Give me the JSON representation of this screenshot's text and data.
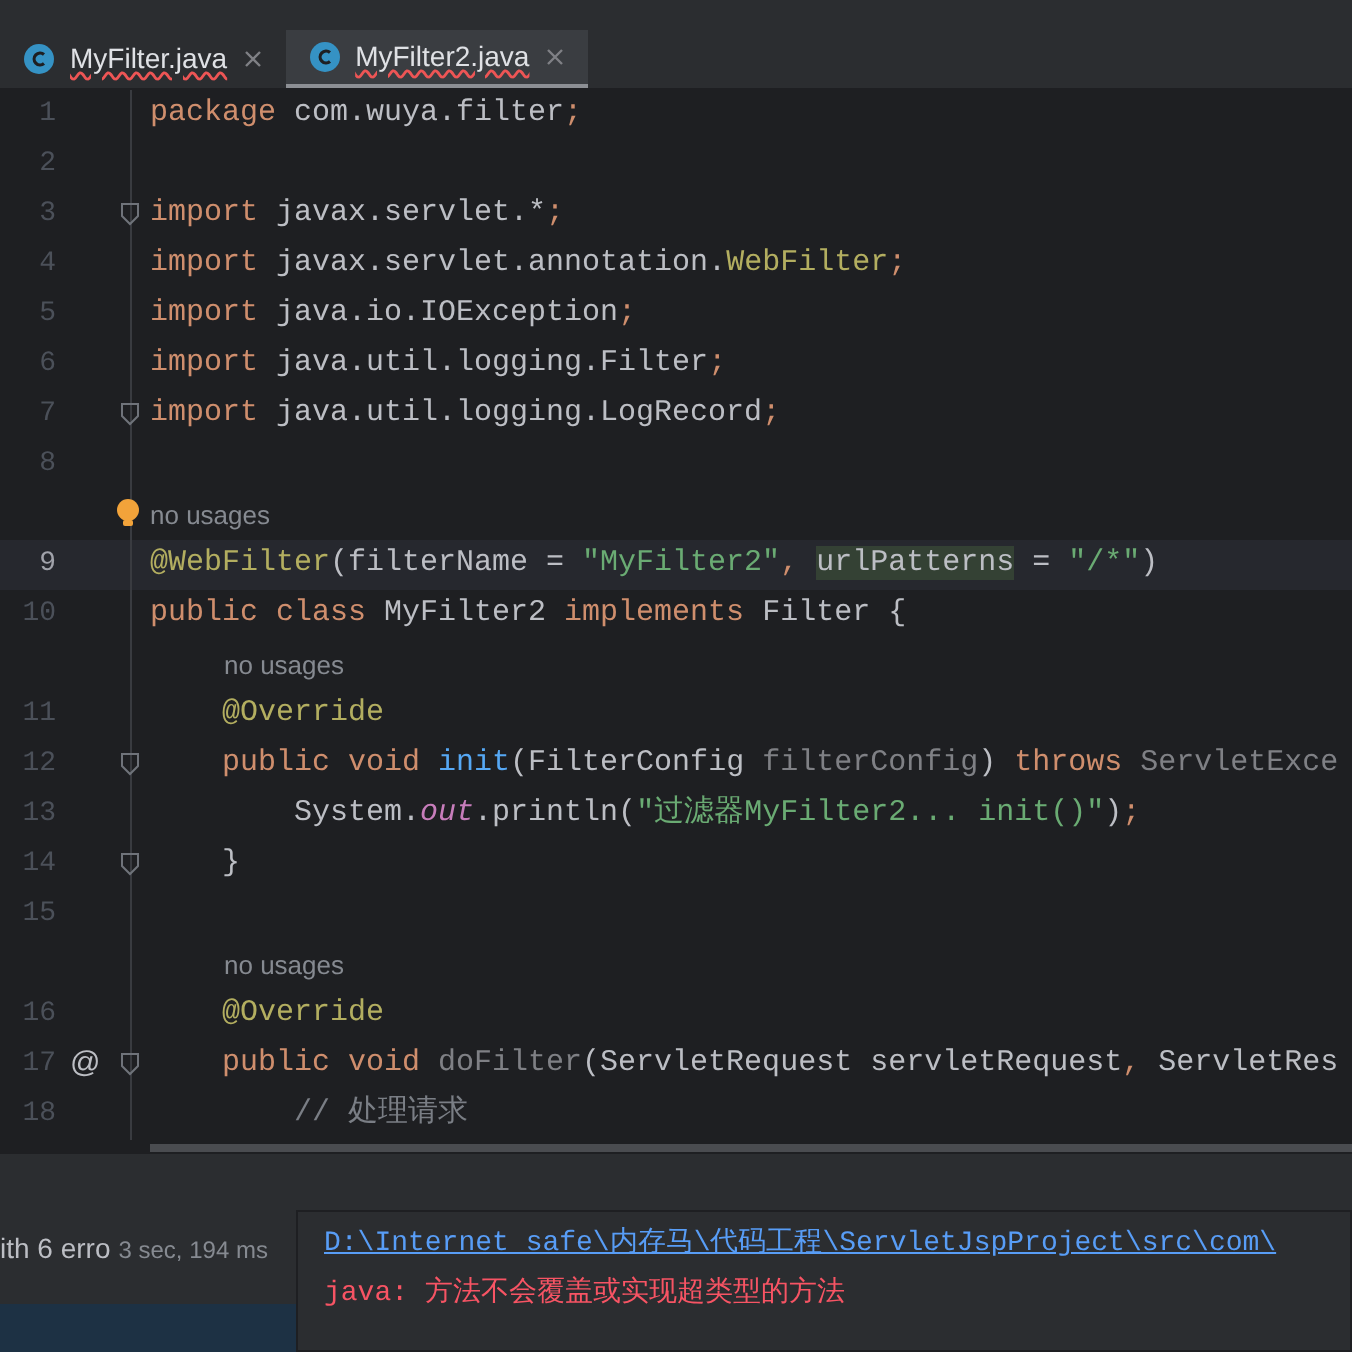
{
  "tabs": [
    {
      "label": "MyFilter.java",
      "selected": false
    },
    {
      "label": "MyFilter2.java",
      "selected": true
    }
  ],
  "lines": [
    {
      "kind": "code",
      "number": "1",
      "fold": false,
      "current": false,
      "tokens": [
        {
          "kind": "kw",
          "s": "package "
        },
        {
          "kind": "plain",
          "s": "com.wuya.filter"
        },
        {
          "kind": "kw",
          "s": ";"
        }
      ]
    },
    {
      "kind": "code",
      "number": "2",
      "fold": false,
      "current": false
    },
    {
      "kind": "code",
      "number": "3",
      "fold": true,
      "current": false,
      "tokens": [
        {
          "kind": "kw",
          "s": "import "
        },
        {
          "kind": "plain",
          "s": "javax.servlet.*"
        },
        {
          "kind": "kw",
          "s": ";"
        }
      ]
    },
    {
      "kind": "code",
      "number": "4",
      "fold": false,
      "current": false,
      "tokens": [
        {
          "kind": "kw",
          "s": "import "
        },
        {
          "kind": "plain",
          "s": "javax.servlet.annotation."
        },
        {
          "kind": "ann",
          "s": "WebFilter"
        },
        {
          "kind": "kw",
          "s": ";"
        }
      ]
    },
    {
      "kind": "code",
      "number": "5",
      "fold": false,
      "current": false,
      "tokens": [
        {
          "kind": "kw",
          "s": "import "
        },
        {
          "kind": "plain",
          "s": "java.io.IOException"
        },
        {
          "kind": "kw",
          "s": ";"
        }
      ]
    },
    {
      "kind": "code",
      "number": "6",
      "fold": false,
      "current": false,
      "tokens": [
        {
          "kind": "kw",
          "s": "import "
        },
        {
          "kind": "plain",
          "s": "java.util.logging.Filter"
        },
        {
          "kind": "kw",
          "s": ";"
        }
      ]
    },
    {
      "kind": "code",
      "number": "7",
      "fold": true,
      "current": false,
      "tokens": [
        {
          "kind": "kw",
          "s": "import "
        },
        {
          "kind": "plain",
          "s": "java.util.logging.LogRecord"
        },
        {
          "kind": "kw",
          "s": ";"
        }
      ]
    },
    {
      "kind": "code",
      "number": "8",
      "fold": false,
      "current": false
    },
    {
      "kind": "hint",
      "nested": false,
      "text": "no usages",
      "bulb": true
    },
    {
      "kind": "code",
      "number": "9",
      "fold": false,
      "current": true,
      "tokens": [
        {
          "kind": "ann",
          "s": "@WebFilter"
        },
        {
          "kind": "plain",
          "s": "(filterName = "
        },
        {
          "kind": "str",
          "s": "\"MyFilter2\""
        },
        {
          "kind": "kw",
          "s": ", "
        },
        {
          "kind": "hl",
          "s": "urlPatterns"
        },
        {
          "kind": "plain",
          "s": " = "
        },
        {
          "kind": "str",
          "s": "\"/*\""
        },
        {
          "kind": "plain",
          "s": ")"
        }
      ]
    },
    {
      "kind": "code",
      "number": "10",
      "fold": false,
      "current": false,
      "tokens": [
        {
          "kind": "kw",
          "s": "public class "
        },
        {
          "kind": "plain",
          "s": "MyFilter2 "
        },
        {
          "kind": "kw",
          "s": "implements "
        },
        {
          "kind": "plain",
          "s": "Filter {"
        }
      ]
    },
    {
      "kind": "hint",
      "nested": true,
      "text": "no usages",
      "bulb": false
    },
    {
      "kind": "code",
      "number": "11",
      "fold": false,
      "current": false,
      "tokens": [
        {
          "kind": "ann",
          "s": "    @Override"
        }
      ]
    },
    {
      "kind": "code",
      "number": "12",
      "fold": true,
      "current": false,
      "tokens": [
        {
          "kind": "kw",
          "s": "    public void "
        },
        {
          "kind": "fn",
          "s": "init"
        },
        {
          "kind": "plain",
          "s": "(FilterConfig "
        },
        {
          "kind": "dim",
          "s": "filterConfig"
        },
        {
          "kind": "plain",
          "s": ") "
        },
        {
          "kind": "kw",
          "s": "throws "
        },
        {
          "kind": "dim",
          "s": "ServletExce"
        }
      ]
    },
    {
      "kind": "code",
      "number": "13",
      "fold": false,
      "current": false,
      "tokens": [
        {
          "kind": "plain",
          "s": "        System."
        },
        {
          "kind": "static",
          "s": "out"
        },
        {
          "kind": "plain",
          "s": ".println("
        },
        {
          "kind": "str",
          "s": "\"过滤器MyFilter2... init()\""
        },
        {
          "kind": "plain",
          "s": ")"
        },
        {
          "kind": "kw",
          "s": ";"
        }
      ]
    },
    {
      "kind": "code",
      "number": "14",
      "fold": true,
      "current": false,
      "tokens": [
        {
          "kind": "plain",
          "s": "    }"
        }
      ]
    },
    {
      "kind": "code",
      "number": "15",
      "fold": false,
      "current": false
    },
    {
      "kind": "hint",
      "nested": true,
      "text": "no usages",
      "bulb": false
    },
    {
      "kind": "code",
      "number": "16",
      "fold": false,
      "current": false,
      "tokens": [
        {
          "kind": "ann",
          "s": "    @Override"
        }
      ]
    },
    {
      "kind": "code",
      "number": "17",
      "fold": true,
      "current": false,
      "marker": "@",
      "tokens": [
        {
          "kind": "kw",
          "s": "    public void "
        },
        {
          "kind": "dim",
          "s": "doFilter"
        },
        {
          "kind": "plain",
          "s": "(ServletRequest servletRequest"
        },
        {
          "kind": "kw",
          "s": ", "
        },
        {
          "kind": "plain",
          "s": "ServletRes"
        }
      ]
    },
    {
      "kind": "code",
      "number": "18",
      "fold": false,
      "current": false,
      "tokens": [
        {
          "kind": "comment",
          "s": "        // 处理请求"
        }
      ]
    }
  ],
  "build": {
    "status": "ith 6 erro",
    "time": "3 sec, 194 ms"
  },
  "popup": {
    "path": "D:\\Internet safe\\内存马\\代码工程\\ServletJspProject\\src\\com\\",
    "message": "java: 方法不会覆盖或实现超类型的方法"
  }
}
